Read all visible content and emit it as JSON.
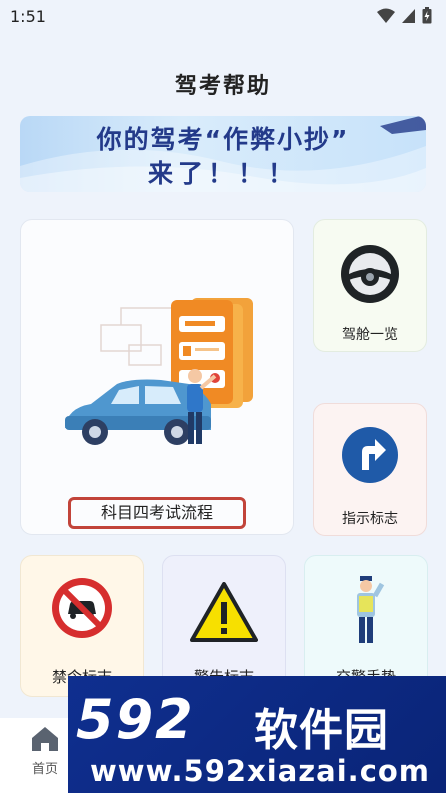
{
  "status_bar": {
    "time": "1:51"
  },
  "header": {
    "title": "驾考帮助"
  },
  "banner": {
    "line1": "你的驾考“作弊小抄”",
    "line2": "来了！！！"
  },
  "cards": {
    "exam_flow": "科目四考试流程",
    "cockpit": "驾舱一览",
    "road_signs": "指示标志",
    "prohibition_signs": "禁令标志",
    "warning_signs": "警告标志",
    "police_gestures": "交警手势"
  },
  "tab_bar": {
    "home": "首页"
  },
  "watermark": {
    "number": "592",
    "name": "软件园",
    "url": "www.592xiazai.com"
  },
  "colors": {
    "accent_blue": "#2f6fc6",
    "flow_border": "#c2443a",
    "watermark_bg": "#0f2f8f"
  }
}
